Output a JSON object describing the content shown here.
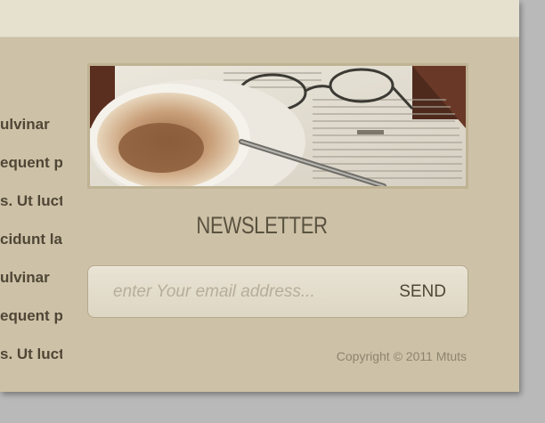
{
  "body_text": {
    "lines": [
      "ulvinar",
      "equent pe",
      "s. Ut luct",
      "cidunt la",
      "ulvinar",
      "equent pe",
      "s. Ut luct"
    ]
  },
  "newsletter": {
    "title": "NEWSLETTER",
    "email_placeholder": "enter Your email address...",
    "send_label": "SEND"
  },
  "footer": {
    "copyright": "Copyright © 2011 Mtuts"
  },
  "colors": {
    "panel_bg": "#cdc2a7",
    "top_strip": "#e6e1cf",
    "page_bg": "#b9b9b9",
    "text_dark": "#4f4636"
  }
}
